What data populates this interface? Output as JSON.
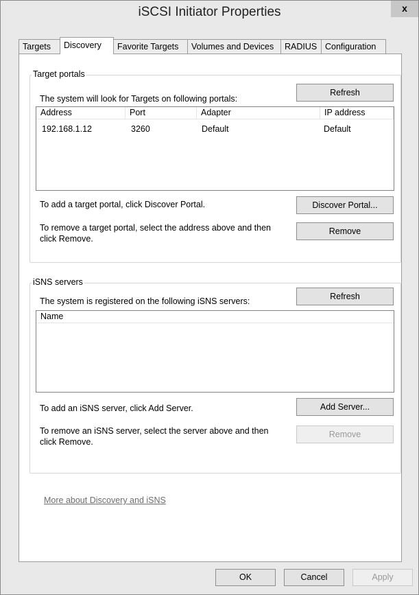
{
  "window": {
    "title": "iSCSI Initiator Properties",
    "close_glyph": "x"
  },
  "tabs": [
    "Targets",
    "Discovery",
    "Favorite Targets",
    "Volumes and Devices",
    "RADIUS",
    "Configuration"
  ],
  "target_portals": {
    "group_label": "Target portals",
    "intro": "The system will look for Targets on following portals:",
    "refresh_label": "Refresh",
    "columns": [
      "Address",
      "Port",
      "Adapter",
      "IP address"
    ],
    "rows": [
      [
        "192.168.1.12",
        "3260",
        "Default",
        "Default"
      ]
    ],
    "add_text": "To add a target portal, click Discover Portal.",
    "discover_label": "Discover Portal...",
    "remove_text": "To remove a target portal, select the address above and then click Remove.",
    "remove_label": "Remove"
  },
  "isns_servers": {
    "group_label": "iSNS servers",
    "intro": "The system is registered on the following iSNS servers:",
    "refresh_label": "Refresh",
    "columns": [
      "Name"
    ],
    "add_text": "To add an iSNS server, click Add Server.",
    "add_label": "Add Server...",
    "remove_text": "To remove an iSNS server, select the server above and then click Remove.",
    "remove_label": "Remove"
  },
  "more_link": "More about Discovery and iSNS",
  "footer": {
    "ok": "OK",
    "cancel": "Cancel",
    "apply": "Apply"
  }
}
